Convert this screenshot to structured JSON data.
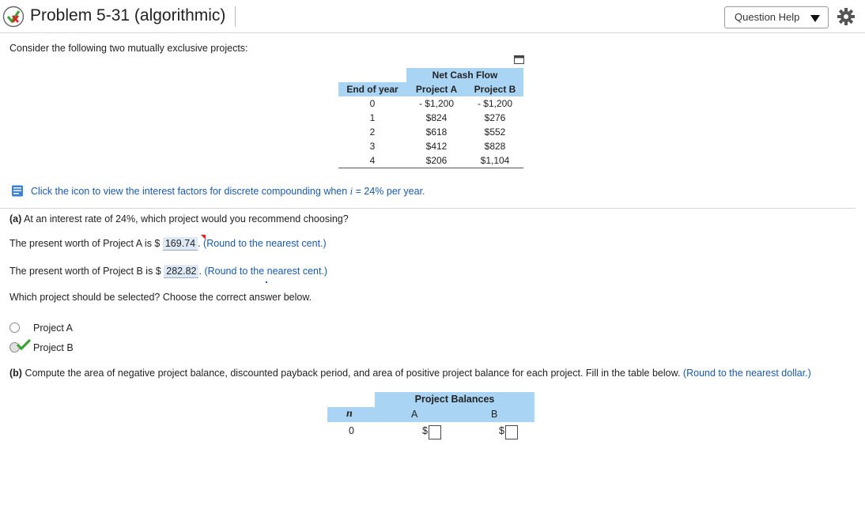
{
  "header": {
    "title": "Problem 5-31 (algorithmic)",
    "question_help": "Question Help"
  },
  "intro": "Consider the following two mutually exclusive projects:",
  "cash_flow_table": {
    "group_header": "Net Cash Flow",
    "col_year": "End of year",
    "col_a": "Project A",
    "col_b": "Project B",
    "rows": [
      {
        "year": "0",
        "a": "- $1,200",
        "b": "- $1,200"
      },
      {
        "year": "1",
        "a": "$824",
        "b": "$276"
      },
      {
        "year": "2",
        "a": "$618",
        "b": "$552"
      },
      {
        "year": "3",
        "a": "$412",
        "b": "$828"
      },
      {
        "year": "4",
        "a": "$206",
        "b": "$1,104"
      }
    ]
  },
  "hint": {
    "pre": "Click the icon to view the interest factors for discrete compounding when ",
    "var": "i",
    "post": " = 24% per year."
  },
  "part_a": {
    "label": "(a)",
    "question": " At an interest rate of 24%, which project would you recommend choosing?",
    "pw_a_pre": "The present worth of Project A is $",
    "pw_a_value": "169.74",
    "pw_b_pre": "The present worth of Project B is $",
    "pw_b_value": "282.82",
    "round_note": "(Round to the nearest cent.)",
    "select_prompt": "Which project should be selected? Choose the correct answer below.",
    "options": [
      {
        "label": "Project A",
        "selected": false
      },
      {
        "label": "Project B",
        "selected": true
      }
    ]
  },
  "part_b": {
    "label": "(b)",
    "question": " Compute the area of negative project balance, discounted payback period, and area of positive project balance for each project. Fill in the table below.",
    "round_note": "(Round to the nearest dollar.)",
    "table": {
      "title": "Project Balances",
      "col_n": "n",
      "col_a": "A",
      "col_b": "B",
      "row_n": "0",
      "currency": "$"
    }
  },
  "colors": {
    "table_header": "#a9d4f3",
    "link_blue": "#1a5aa8",
    "correct_green": "#3aa335",
    "flag_red": "#e02020"
  }
}
